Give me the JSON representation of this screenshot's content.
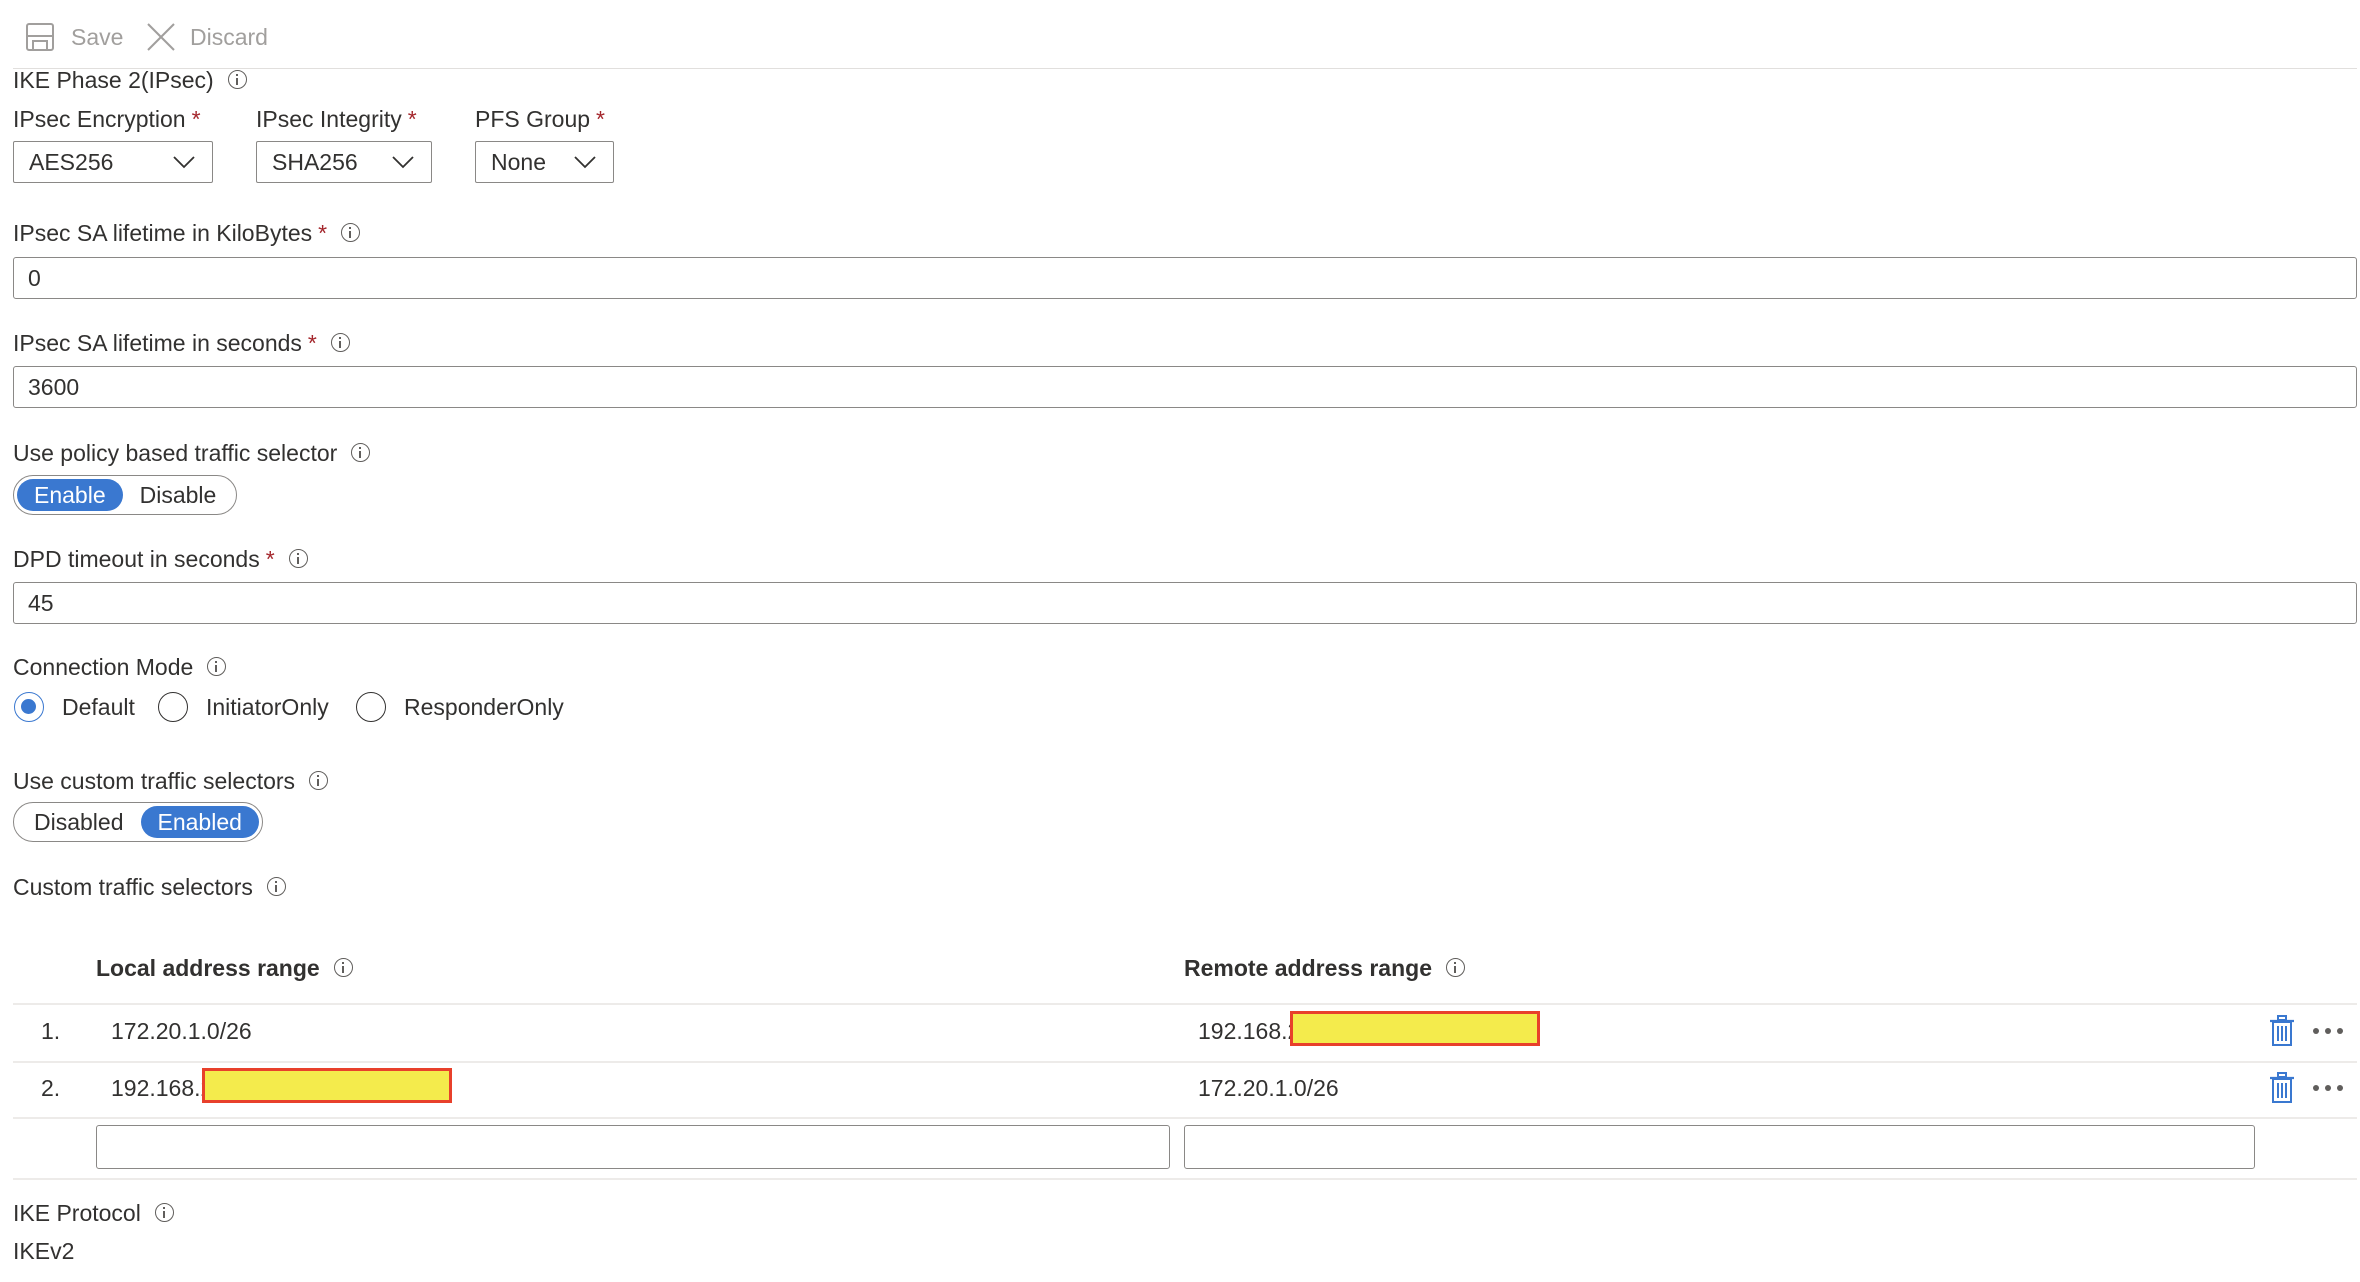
{
  "toolbar": {
    "save_label": "Save",
    "save_icon": "save-icon",
    "discard_label": "Discard",
    "discard_icon": "close-icon"
  },
  "section": {
    "title": "IKE Phase 2(IPsec)"
  },
  "ipsec_encryption": {
    "label": "IPsec Encryption",
    "required": "*",
    "value": "AES256"
  },
  "ipsec_integrity": {
    "label": "IPsec Integrity",
    "required": "*",
    "value": "SHA256"
  },
  "pfs_group": {
    "label": "PFS Group",
    "required": "*",
    "value": "None"
  },
  "sa_lifetime_kb": {
    "label": "IPsec SA lifetime in KiloBytes",
    "required": "*",
    "value": "0"
  },
  "sa_lifetime_sec": {
    "label": "IPsec SA lifetime in seconds",
    "required": "*",
    "value": "3600"
  },
  "policy_selector": {
    "label": "Use policy based traffic selector",
    "options": [
      "Enable",
      "Disable"
    ],
    "selected": "Enable"
  },
  "dpd_timeout": {
    "label": "DPD timeout in seconds",
    "required": "*",
    "value": "45"
  },
  "connection_mode": {
    "label": "Connection Mode",
    "options": [
      "Default",
      "InitiatorOnly",
      "ResponderOnly"
    ],
    "selected": "Default"
  },
  "custom_selectors_toggle": {
    "label": "Use custom traffic selectors",
    "options": [
      "Disabled",
      "Enabled"
    ],
    "selected": "Enabled"
  },
  "custom_selectors": {
    "label": "Custom traffic selectors",
    "columns": [
      "Local address range",
      "Remote address range"
    ],
    "rows": [
      {
        "index": "1.",
        "local": "172.20.1.0/26",
        "remote": "192.168.2",
        "remote_redacted": true
      },
      {
        "index": "2.",
        "local": "192.168.2",
        "local_redacted": true,
        "remote": "172.20.1.0/26"
      }
    ],
    "new_local_value": "",
    "new_remote_value": "",
    "row_actions": {
      "delete_icon": "trash-icon",
      "more_icon": "more-icon"
    }
  },
  "ike_protocol": {
    "label": "IKE Protocol",
    "value": "IKEv2"
  },
  "colors": {
    "accent": "#3a78d0",
    "required": "#a4262c",
    "redaction_fill": "#f4eb4c",
    "redaction_border": "#e8402b"
  }
}
